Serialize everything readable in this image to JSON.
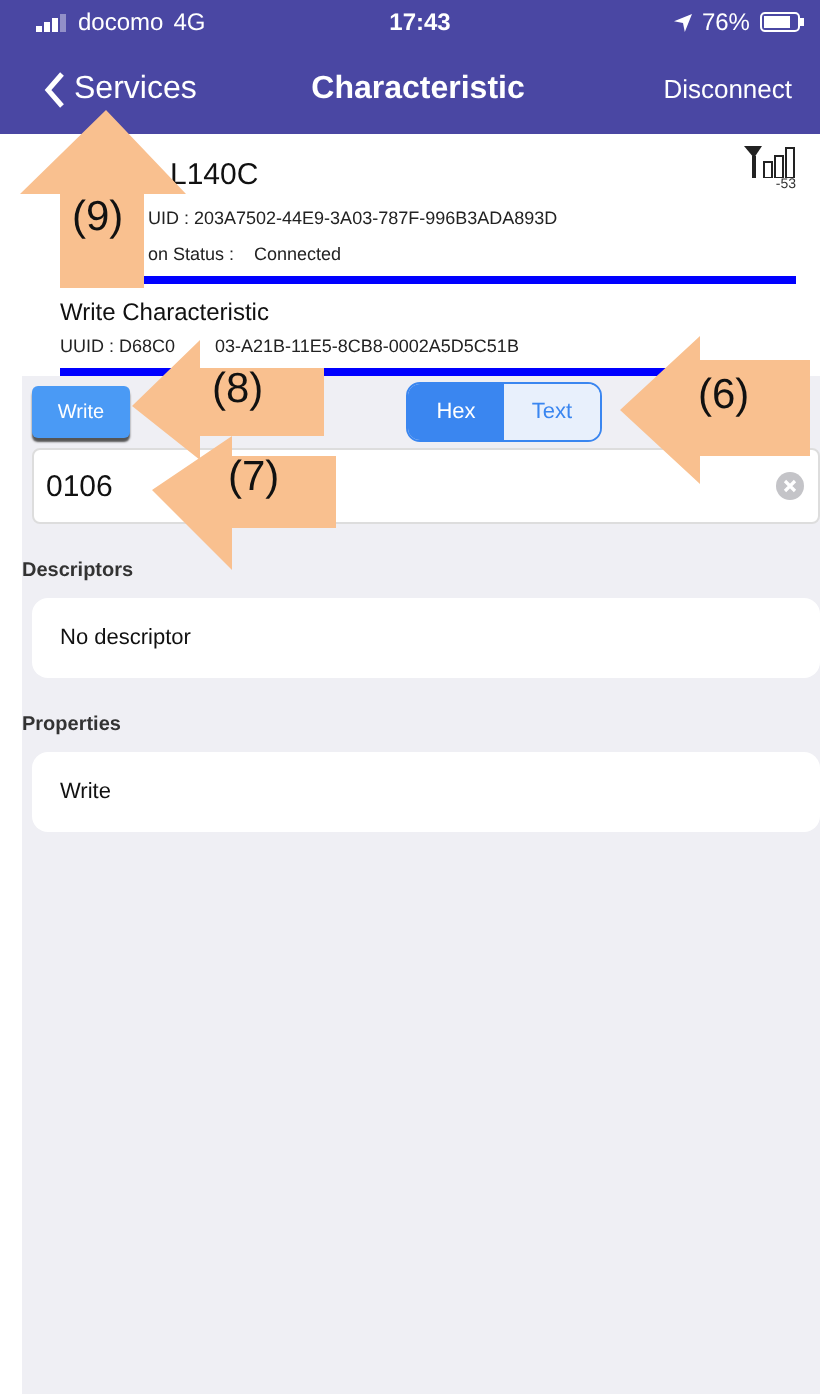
{
  "status_bar": {
    "carrier": "docomo",
    "network": "4G",
    "time": "17:43",
    "battery": "76%"
  },
  "nav": {
    "back": "Services",
    "title": "Characteristic",
    "action": "Disconnect"
  },
  "device": {
    "name": "L140C",
    "uuid": "UID : 203A7502-44E9-3A03-787F-996B3ADA893D",
    "status_label": "on Status :",
    "status": "Connected",
    "rssi": "-53"
  },
  "characteristic": {
    "name": "Write Characteristic",
    "uuid_start": "UUID : D68C0",
    "uuid_end": "03-A21B-11E5-8CB8-0002A5D5C51B"
  },
  "write_button": "Write",
  "format": [
    {
      "label": "Hex",
      "selected": true
    },
    {
      "label": "Text",
      "selected": false
    }
  ],
  "value": "0106",
  "sections": [
    {
      "title": "Descriptors",
      "item": "No descriptor"
    },
    {
      "title": "Properties",
      "item": "Write"
    }
  ],
  "callouts": [
    {
      "label": "(9)",
      "kind": "up"
    },
    {
      "label": "(8)",
      "kind": "left"
    },
    {
      "label": "(7)",
      "kind": "left"
    },
    {
      "label": "(6)",
      "kind": "left"
    }
  ]
}
